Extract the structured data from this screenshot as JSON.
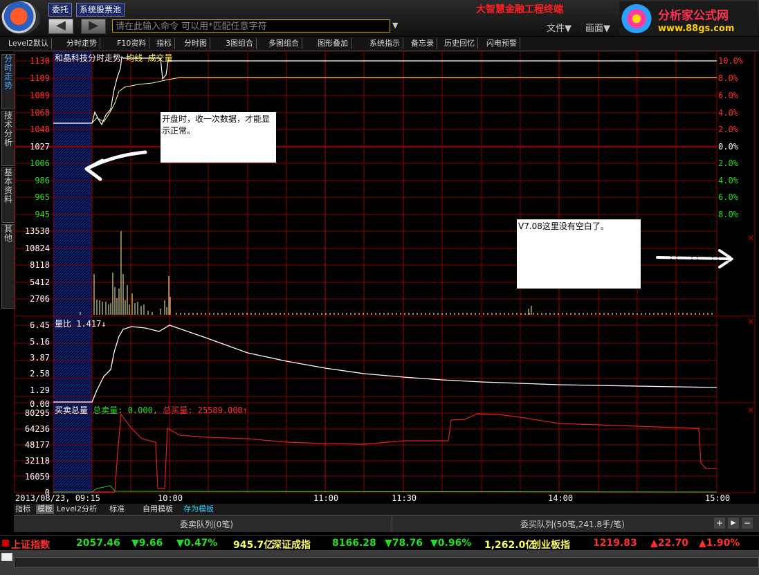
{
  "topbar": {
    "btn_entrust": "委托",
    "btn_pool": "系统股票池",
    "back": "◀",
    "forward": "▶",
    "cmd_text": "请在此输入命令   可以用*匹配任意字符",
    "title": "大智慧金融工程终端",
    "menu_file": "文件▼",
    "menu_screen": "画面▼",
    "ad_text": "分析家公式网",
    "ad_url": "www.88gs.com"
  },
  "toolbar": [
    "Level2默认",
    "分时走势",
    "F10资料",
    "指标",
    "分时图",
    "3图组合",
    "多图组合",
    "图形叠加",
    "系统指示",
    "备忘录",
    "历史回忆",
    "闪电预警"
  ],
  "side_tabs": [
    "分时走势",
    "技术分析",
    "基本资料",
    "其他"
  ],
  "price_panel": {
    "title": "和晶科技分时走势",
    "avg_label": "均线",
    "vol_label": "成交量",
    "price_ticks": [
      "1130",
      "1109",
      "1089",
      "1068",
      "1048",
      "1027",
      "1006",
      "986",
      "965",
      "945"
    ],
    "pct_ticks": [
      "10.0%",
      "8.0%",
      "6.0%",
      "4.0%",
      "2.0%",
      "0.0%",
      "2.0%",
      "4.0%",
      "6.0%",
      "8.0%"
    ],
    "vol_ticks": [
      "13530",
      "10824",
      "8118",
      "5412",
      "2706"
    ]
  },
  "annotations": {
    "note1": "开盘时，收一次数据，才能显示正常。",
    "note2": "V7.08这里没有空白了。"
  },
  "ratio_panel": {
    "title": "量比 1.417↓",
    "ticks": [
      "6.45",
      "5.16",
      "3.87",
      "2.58",
      "1.29",
      "0.00"
    ]
  },
  "bs_panel": {
    "title": "买卖总量",
    "sell": "总卖量: 0.000,",
    "buy": "总买量: 25589.000↑",
    "ticks": [
      "80295",
      "64236",
      "48177",
      "32118",
      "16059",
      "0"
    ]
  },
  "time_axis": {
    "date": "2013/08/23, 09:15",
    "labels": [
      "10:00",
      "11:00",
      "11:30",
      "14:00",
      "15:00"
    ]
  },
  "bottom_tabs": [
    "指标",
    "模板",
    "Level2分析",
    "标准",
    "自用模板",
    "存为模板"
  ],
  "queues": {
    "sell": "委卖队列(0笔)",
    "buy": "委买队列(50笔,241.8手/笔)"
  },
  "ticker": {
    "sh_name": "上证指数",
    "sh_val": "2057.46",
    "sh_chg": "▼9.66",
    "sh_pct": "▼0.47%",
    "sh_amt": "945.7亿",
    "sz_name": "深证成指",
    "sz_val": "8166.28",
    "sz_chg": "▼78.76",
    "sz_pct": "▼0.96%",
    "sz_amt": "1,262.0亿",
    "cy_name": "创业板指",
    "cy_val": "1219.83",
    "cy_chg": "▲22.70",
    "cy_pct": "▲1.90%"
  },
  "colors": {
    "up": "#ff3030",
    "down": "#22dd22",
    "grid": "#8b0000",
    "price_line": "#ffffff",
    "avg_line": "#ffff80",
    "bs_line": "#dd2222"
  }
}
